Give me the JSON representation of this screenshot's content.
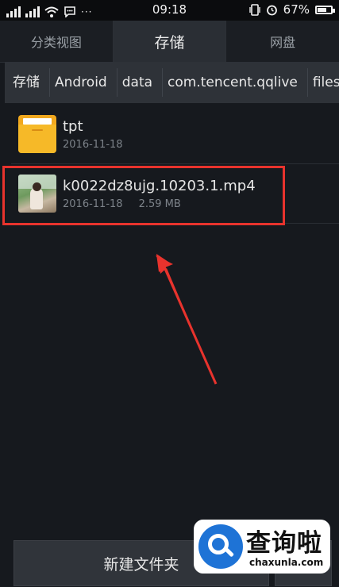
{
  "status_bar": {
    "time": "09:18",
    "battery_percent": "67%",
    "battery_level": 0.67
  },
  "tabs": [
    {
      "label": "分类视图",
      "active": false
    },
    {
      "label": "存储",
      "active": true
    },
    {
      "label": "网盘",
      "active": false
    }
  ],
  "breadcrumb": [
    "存储",
    "Android",
    "data",
    "com.tencent.qqlive",
    "files"
  ],
  "files": [
    {
      "name": "tpt",
      "date": "2016-11-18",
      "size": "",
      "icon": "folder-icon"
    },
    {
      "name": "k0022dz8ujg.10203.1.mp4",
      "date": "2016-11-18",
      "size": "2.59 MB",
      "icon": "video-thumbnail"
    }
  ],
  "bottom_bar": {
    "new_folder_label": "新建文件夹"
  },
  "watermark": {
    "cn": "查询啦",
    "en": "chaxunla.com"
  },
  "colors": {
    "highlight": "#e8332d",
    "arrow": "#e8332d",
    "folder": "#f1a81e",
    "watermark_blue": "#1e73d6"
  }
}
